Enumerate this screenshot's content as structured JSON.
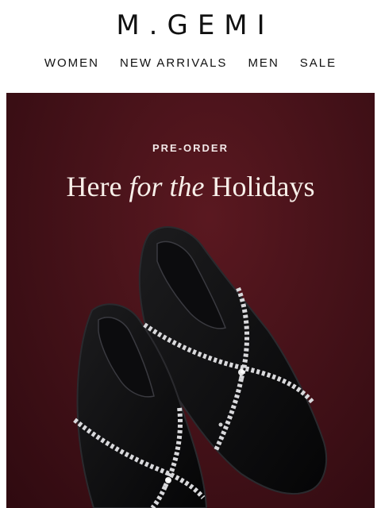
{
  "brand": {
    "logo": "M.GEMI"
  },
  "nav": {
    "items": [
      {
        "label": "WOMEN"
      },
      {
        "label": "NEW ARRIVALS"
      },
      {
        "label": "MEN"
      },
      {
        "label": "SALE"
      }
    ]
  },
  "hero": {
    "eyebrow": "PRE-ORDER",
    "headline_part1": "Here ",
    "headline_italic": "for the",
    "headline_part2": " Holidays",
    "image_subject": "black suede flats with crystal cross straps",
    "background_color": "#461219"
  }
}
